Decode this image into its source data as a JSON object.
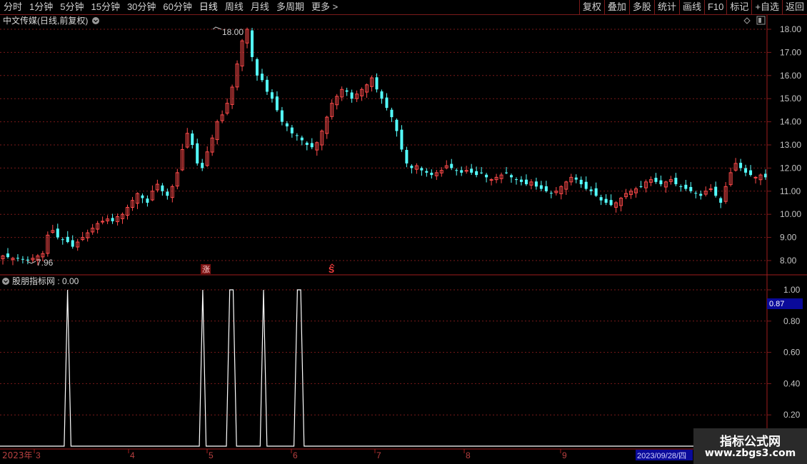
{
  "toolbar": {
    "periods": [
      "分时",
      "1分钟",
      "5分钟",
      "15分钟",
      "30分钟",
      "60分钟",
      "日线",
      "周线",
      "月线",
      "多周期",
      "更多 >"
    ],
    "active_period": "日线",
    "buttons": [
      "复权",
      "叠加",
      "多股",
      "统计",
      "画线",
      "F10",
      "标记",
      "+自选",
      "返回"
    ]
  },
  "price_panel": {
    "title": "中文传媒(日线,前复权)",
    "high_label": "18.00",
    "low_label": "7.96",
    "marker_up": "涨",
    "marker_s": "S"
  },
  "indicator_panel": {
    "title": "股朋指标网 : 0.00",
    "cursor_value": "0.87"
  },
  "x_axis": {
    "year_label": "2023年",
    "month_labels": [
      "3",
      "4",
      "5",
      "6",
      "7",
      "8",
      "9"
    ],
    "cursor_date": "2023/09/28/四"
  },
  "watermark": {
    "line1": "指标公式网",
    "line2": "www.zbgs3.com"
  },
  "colors": {
    "up": "#ff4a4a",
    "down": "#54ffff",
    "grid": "#7a1a1a",
    "axis_text": "#c4c4c4",
    "indicator_line": "#ffffff"
  },
  "chart_data": [
    {
      "type": "candlestick",
      "title": "中文传媒(日线,前复权)",
      "ylim": [
        7.6,
        18.3
      ],
      "y_ticks": [
        8.0,
        9.0,
        10.0,
        11.0,
        12.0,
        13.0,
        14.0,
        15.0,
        16.0,
        17.0,
        18.0
      ],
      "x_month_labels": [
        "3",
        "4",
        "5",
        "6",
        "7",
        "8",
        "9"
      ],
      "annotations": [
        {
          "text": "18.00",
          "type": "max"
        },
        {
          "text": "7.96",
          "type": "min"
        }
      ],
      "close_path": [
        8.2,
        8.15,
        8.1,
        8.1,
        8.05,
        8.0,
        8.1,
        8.2,
        8.3,
        9.1,
        9.3,
        9.0,
        8.9,
        8.8,
        8.6,
        8.8,
        9.0,
        9.2,
        9.4,
        9.6,
        9.7,
        9.8,
        9.7,
        9.9,
        10.0,
        10.3,
        10.6,
        10.9,
        10.7,
        10.5,
        11.0,
        11.3,
        11.0,
        10.8,
        11.2,
        11.8,
        12.8,
        13.5,
        13.0,
        12.2,
        12.0,
        12.7,
        13.3,
        14.0,
        14.3,
        14.8,
        15.5,
        16.5,
        17.5,
        18.0,
        16.8,
        16.0,
        15.8,
        15.3,
        15.0,
        14.5,
        14.0,
        13.8,
        13.5,
        13.4,
        13.2,
        13.0,
        12.9,
        13.1,
        13.6,
        14.2,
        14.8,
        15.1,
        15.4,
        15.3,
        15.0,
        15.2,
        15.4,
        15.6,
        15.9,
        15.4,
        15.0,
        14.6,
        14.2,
        13.6,
        12.8,
        12.2,
        12.0,
        12.1,
        11.9,
        11.8,
        11.7,
        11.8,
        11.9,
        12.1,
        12.0,
        11.9,
        11.8,
        11.9,
        11.8,
        11.7,
        11.8,
        11.6,
        11.5,
        11.6,
        11.7,
        11.8,
        11.6,
        11.5,
        11.4,
        11.3,
        11.4,
        11.2,
        11.1,
        11.0,
        10.9,
        11.0,
        11.2,
        11.4,
        11.6,
        11.5,
        11.3,
        11.1,
        11.0,
        10.8,
        10.6,
        10.5,
        10.4,
        10.5,
        10.7,
        10.9,
        11.0,
        11.1,
        11.2,
        11.4,
        11.5,
        11.4,
        11.3,
        11.4,
        11.5,
        11.3,
        11.2,
        11.1,
        11.0,
        10.9,
        10.8,
        11.0,
        11.1,
        10.8,
        10.5,
        11.2,
        11.8,
        12.2,
        12.0,
        11.8,
        11.7,
        11.6,
        11.7,
        11.6
      ]
    },
    {
      "type": "line",
      "title": "股朋指标网",
      "ylim": [
        0,
        1.05
      ],
      "y_ticks": [
        0.2,
        0.4,
        0.6,
        0.8,
        1.0
      ],
      "series": [
        {
          "values": [
            0,
            0,
            0,
            0,
            0,
            0,
            0,
            0,
            0,
            0,
            0,
            0,
            0,
            0,
            0,
            0,
            0,
            0,
            0,
            0,
            1,
            0,
            0,
            0,
            0,
            0,
            0,
            0,
            0,
            0,
            0,
            0,
            0,
            0,
            0,
            0,
            0,
            0,
            0,
            0,
            0,
            0,
            0,
            0,
            0,
            0,
            0,
            0,
            0,
            0,
            0,
            0,
            0,
            0,
            0,
            0,
            0,
            0,
            0,
            0,
            1,
            0,
            0,
            0,
            0,
            0,
            0,
            0,
            1,
            1,
            0,
            0,
            0,
            0,
            0,
            0,
            0,
            0,
            1,
            0,
            0,
            0,
            0,
            0,
            0,
            0,
            0,
            0,
            1,
            1,
            0,
            0,
            0,
            0,
            0,
            0,
            0,
            0,
            0,
            0,
            0,
            0,
            0,
            0,
            0,
            0,
            0,
            0,
            0,
            0,
            0,
            0,
            0,
            0,
            0,
            0,
            0,
            0,
            0,
            0,
            0,
            0,
            0,
            0,
            0,
            0,
            0,
            0,
            0,
            0,
            0,
            0,
            0,
            0,
            0,
            0,
            0,
            0,
            0,
            0,
            0,
            0,
            0,
            0,
            0,
            0,
            0,
            0,
            0,
            0,
            0,
            0,
            0,
            0,
            0,
            0,
            0,
            0,
            0,
            0,
            0,
            0,
            0,
            0,
            0,
            0,
            0,
            0,
            0,
            0,
            0,
            0,
            0,
            0,
            0,
            0,
            0,
            0,
            0,
            0,
            0,
            0,
            0,
            0,
            0,
            0,
            0,
            0,
            0,
            0,
            0,
            0,
            0,
            0,
            0,
            0,
            0,
            0,
            0,
            0,
            0,
            0,
            0,
            0,
            0,
            0,
            0,
            0,
            0,
            0,
            0,
            0,
            0,
            0,
            0,
            0,
            0,
            0,
            0,
            0,
            0,
            0,
            0,
            0,
            0,
            0,
            0,
            0
          ]
        }
      ]
    }
  ]
}
